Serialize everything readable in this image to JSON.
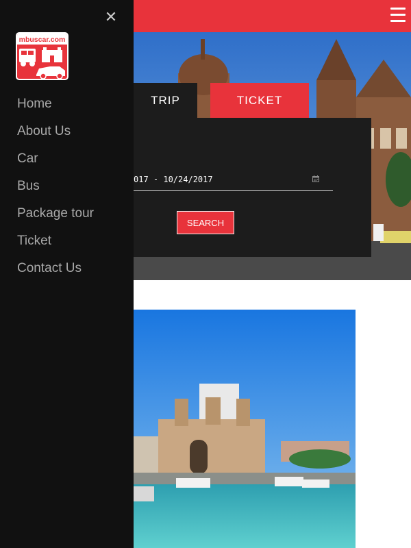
{
  "header": {
    "menu_icon": "hamburger-menu-icon",
    "accent": "#e8333b"
  },
  "drawer": {
    "close_icon": "close-icon",
    "close_glyph": "✕",
    "logo_text": "mbuscar.com",
    "items": [
      {
        "label": "Home"
      },
      {
        "label": "About Us"
      },
      {
        "label": "Car"
      },
      {
        "label": "Bus"
      },
      {
        "label": "Package tour"
      },
      {
        "label": "Ticket"
      },
      {
        "label": "Contact Us"
      }
    ]
  },
  "booking": {
    "tabs": [
      {
        "label": "TRIP"
      },
      {
        "label": "TICKET"
      }
    ],
    "date_range": "017 - 10/24/2017",
    "calendar_icon": "calendar-icon",
    "search_label": "SEARCH"
  }
}
